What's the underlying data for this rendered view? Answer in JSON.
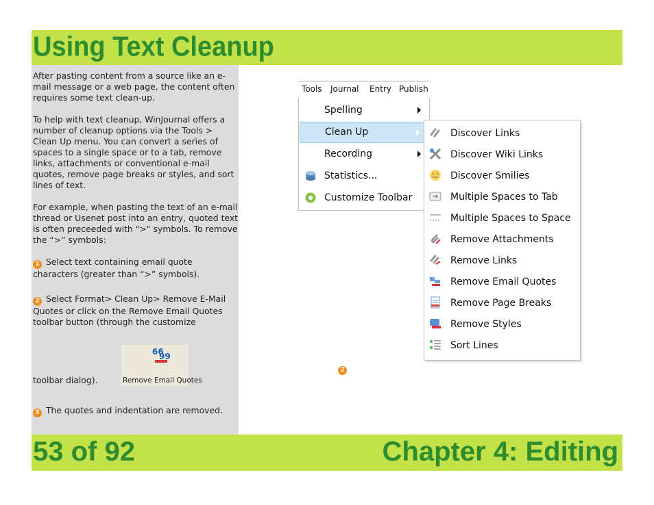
{
  "title": "Using Text Cleanup",
  "paragraphs": [
    "After pasting content from a source like an e-mail message or a web page, the content often requires some text clean-up.",
    "To help with text cleanup, WinJournal offers a number of cleanup options via the Tools > Clean Up menu.  You can convert a series of spaces to a single space or to a tab, remove links, attachments or conventional e-mail quotes, remove page breaks or styles, and sort lines of text.",
    "For example, when pasting the text of an e-mail thread or Usenet post into an entry, quoted text is  often preceeded with \">\" symbols.  To remove the “>” symbols:"
  ],
  "steps": [
    {
      "num": "1",
      "text": " Select text containing email quote characters (greater than “>” symbols)."
    },
    {
      "num": "2",
      "text": " Select Format> Clean Up> Remove E-Mail Quotes or click on the Remove Email Quotes toolbar button (through the customize"
    },
    {
      "num": "3",
      "text": " The quotes and indentation are removed."
    }
  ],
  "after_button_text": "toolbar dialog).",
  "toolbar_button_label": "Remove Email Quotes",
  "menubar": {
    "tools": "Tools",
    "journal": "Journal",
    "entry": "Entry",
    "publish": "Publish"
  },
  "tools_menu": [
    {
      "label": "Spelling",
      "submenu": true,
      "icon": "none"
    },
    {
      "label": "Clean Up",
      "submenu": true,
      "highlighted": true,
      "icon": "none"
    },
    {
      "label": "Recording",
      "submenu": true,
      "icon": "none"
    },
    {
      "label": "Statistics...",
      "icon": "database-icon"
    },
    {
      "label": "Customize Toolbar",
      "icon": "gear-icon"
    }
  ],
  "cleanup_menu": [
    {
      "label": "Discover Links",
      "icon": "link-icon"
    },
    {
      "label": "Discover Wiki Links",
      "icon": "wiki-tools-icon"
    },
    {
      "label": "Discover Smilies",
      "icon": "smiley-icon"
    },
    {
      "label": "Multiple Spaces to Tab",
      "icon": "tab-icon"
    },
    {
      "label": "Multiple Spaces to Space",
      "icon": "space-icon"
    },
    {
      "label": "Remove Attachments",
      "icon": "paperclip-icon"
    },
    {
      "label": "Remove Links",
      "icon": "remove-link-icon"
    },
    {
      "label": "Remove Email Quotes",
      "icon": "quote-icon"
    },
    {
      "label": "Remove Page Breaks",
      "icon": "page-break-icon"
    },
    {
      "label": "Remove Styles",
      "icon": "styles-icon"
    },
    {
      "label": "Sort Lines",
      "icon": "sort-icon"
    }
  ],
  "image_marker": "2",
  "footer": {
    "page": "53 of 92",
    "chapter": "Chapter 4: Editing"
  },
  "colors": {
    "bar": "#c3e24a",
    "title_text": "#2c8c2e",
    "panel": "#dcdcdc",
    "step_badge": "#f28b20",
    "menu_highlight": "#cde6f7"
  }
}
